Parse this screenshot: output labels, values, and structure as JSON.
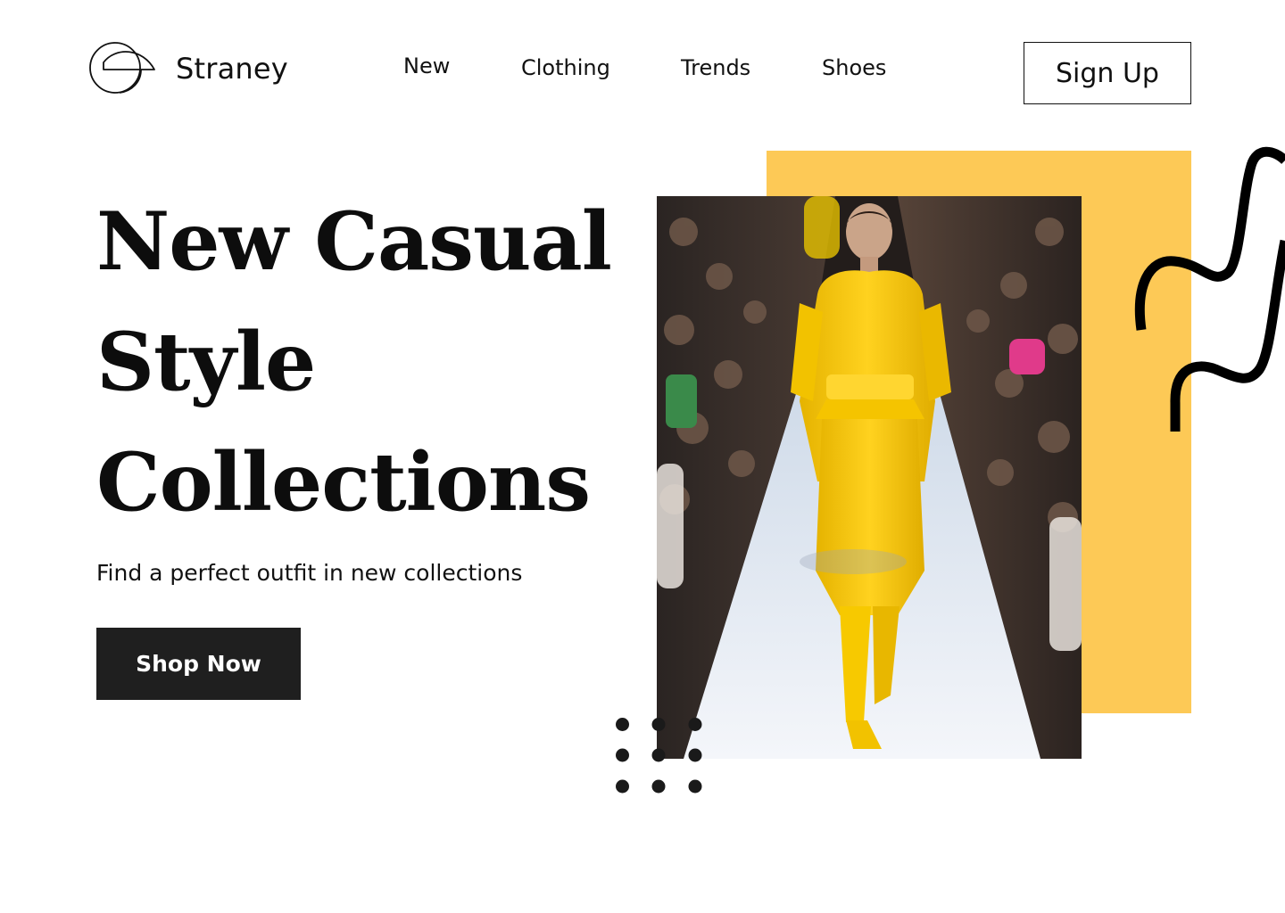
{
  "header": {
    "brand": "Straney",
    "logo_icon": "overlapping-circles-logo-icon",
    "nav": [
      "New",
      "Clothing",
      "Trends",
      "Shoes"
    ],
    "signup_label": "Sign Up"
  },
  "hero": {
    "title_lines": [
      "New Casual",
      "Style",
      "Collections"
    ],
    "subtitle": "Find a perfect outfit in new collections",
    "cta_label": "Shop Now",
    "image_subject": "runway-model-yellow-outfit-photo"
  },
  "colors": {
    "accent_yellow": "#fdc956",
    "button_dark": "#1f1f1f",
    "text": "#111111"
  }
}
